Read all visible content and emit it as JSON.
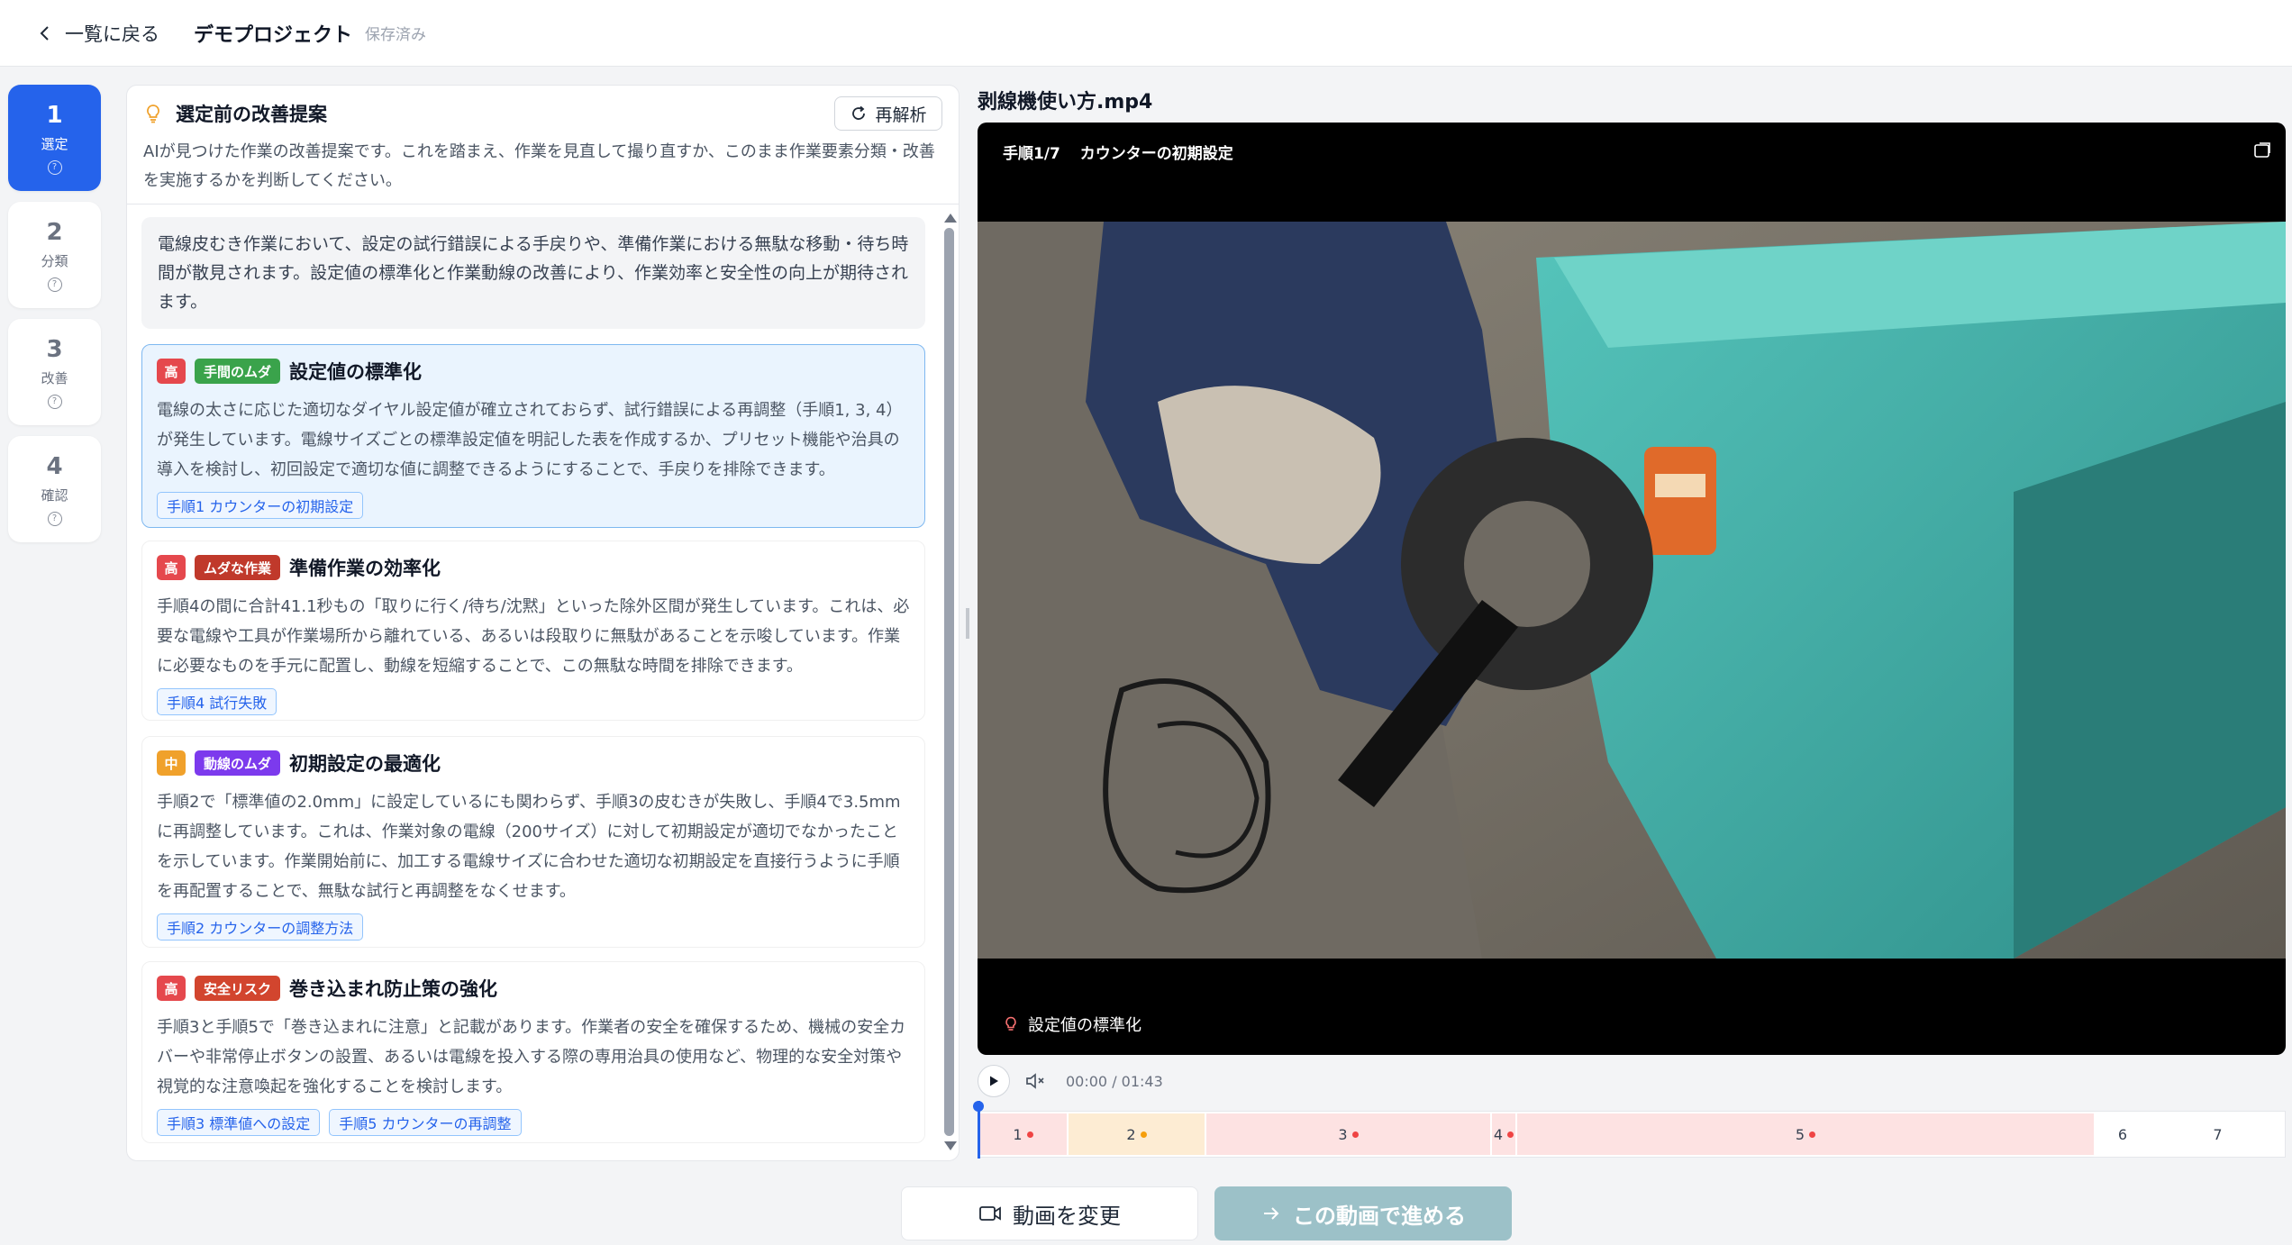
{
  "header": {
    "back_label": "一覧に戻る",
    "project_title": "デモプロジェクト",
    "save_status": "保存済み"
  },
  "steps": [
    {
      "num": "1",
      "label": "選定",
      "active": true
    },
    {
      "num": "2",
      "label": "分類",
      "active": false
    },
    {
      "num": "3",
      "label": "改善",
      "active": false
    },
    {
      "num": "4",
      "label": "確認",
      "active": false
    }
  ],
  "panel": {
    "title": "選定前の改善提案",
    "reanalyze_label": "再解析",
    "description": "AIが見つけた作業の改善提案です。これを踏まえ、作業を見直して撮り直すか、このまま作業要素分類・改善を実施するかを判断してください。",
    "summary": "電線皮むき作業において、設定の試行錯誤による手戻りや、準備作業における無駄な移動・待ち時間が散見されます。設定値の標準化と作業動線の改善により、作業効率と安全性の向上が期待されます。"
  },
  "suggestions": [
    {
      "priority": "高",
      "category": "手間のムダ",
      "title": "設定値の標準化",
      "body": "電線の太さに応じた適切なダイヤル設定値が確立されておらず、試行錯誤による再調整（手順1, 3, 4）が発生しています。電線サイズごとの標準設定値を明記した表を作成するか、プリセット機能や治具の導入を検討し、初回設定で適切な値に調整できるようにすることで、手戻りを排除できます。",
      "tags": [
        "手順1 カウンターの初期設定"
      ]
    },
    {
      "priority": "高",
      "category": "ムダな作業",
      "title": "準備作業の効率化",
      "body": "手順4の間に合計41.1秒もの「取りに行く/待ち/沈黙」といった除外区間が発生しています。これは、必要な電線や工具が作業場所から離れている、あるいは段取りに無駄があることを示唆しています。作業に必要なものを手元に配置し、動線を短縮することで、この無駄な時間を排除できます。",
      "tags": [
        "手順4 試行失敗"
      ]
    },
    {
      "priority": "中",
      "category": "動線のムダ",
      "title": "初期設定の最適化",
      "body": "手順2で「標準値の2.0mm」に設定しているにも関わらず、手順3の皮むきが失敗し、手順4で3.5mmに再調整しています。これは、作業対象の電線（200サイズ）に対して初期設定が適切でなかったことを示しています。作業開始前に、加工する電線サイズに合わせた適切な初期設定を直接行うように手順を再配置することで、無駄な試行と再調整をなくせます。",
      "tags": [
        "手順2 カウンターの調整方法"
      ]
    },
    {
      "priority": "高",
      "category": "安全リスク",
      "title": "巻き込まれ防止策の強化",
      "body": "手順3と手順5で「巻き込まれに注意」と記載があります。作業者の安全を確保するため、機械の安全カバーや非常停止ボタンの設置、あるいは電線を投入する際の専用治具の使用など、物理的な安全対策や視覚的な注意喚起を強化することを検討します。",
      "tags": [
        "手順3 標準値への設定",
        "手順5 カウンターの再調整"
      ]
    }
  ],
  "video": {
    "filename": "剥線機使い方.mp4",
    "step_indicator": "手順1/7",
    "step_title": "カウンターの初期設定",
    "caption": "設定値の標準化",
    "time": "00:00 / 01:43"
  },
  "timeline": [
    {
      "label": "1",
      "dot": true,
      "dot_color": "#ef4444",
      "bg": "#fde2e2"
    },
    {
      "label": "2",
      "dot": true,
      "dot_color": "#f59e0b",
      "bg": "#fdecd3"
    },
    {
      "label": "3",
      "dot": true,
      "dot_color": "#ef4444",
      "bg": "#fde2e2"
    },
    {
      "label": "4",
      "dot": true,
      "dot_color": "#ef4444",
      "bg": "#fde2e2"
    },
    {
      "label": "5",
      "dot": true,
      "dot_color": "#ef4444",
      "bg": "#fde2e2"
    },
    {
      "label": "6",
      "dot": false,
      "dot_color": "",
      "bg": "#ffffff"
    },
    {
      "label": "7",
      "dot": false,
      "dot_color": "",
      "bg": "#ffffff"
    }
  ],
  "bottom": {
    "change_label": "動画を変更",
    "proceed_label": "この動画で進める"
  },
  "colors": {
    "accent": "#2563eb",
    "priority_high": "#e5484d",
    "priority_mid": "#f0a12b",
    "category_effort": "#3aa34b",
    "category_waste": "#c0392b",
    "category_movement": "#7c3aed",
    "category_safety": "#d2452e"
  }
}
